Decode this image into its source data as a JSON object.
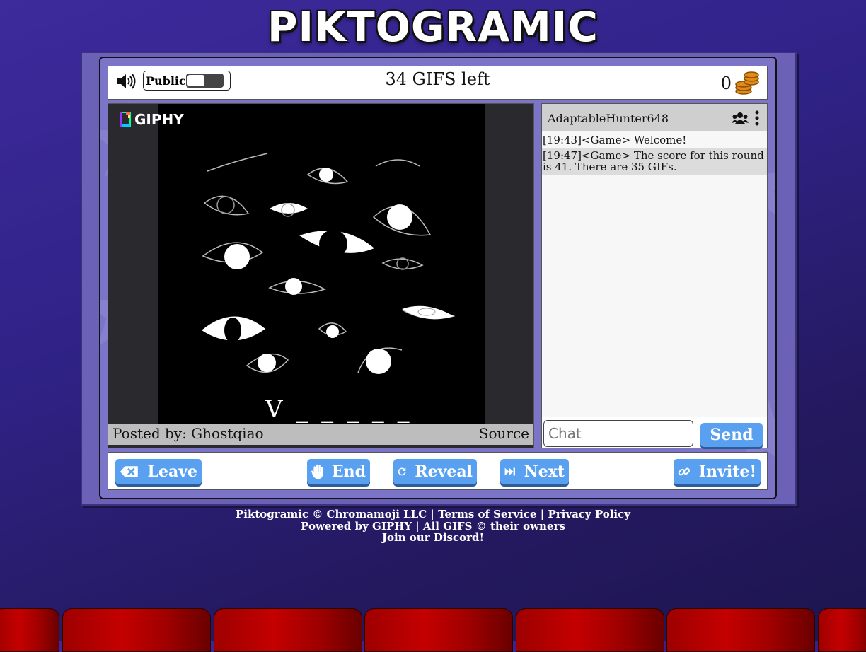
{
  "app": {
    "logo_text": "PIKTOGRAMIC"
  },
  "topbar": {
    "sound_icon": "speaker-icon",
    "public_label": "Public",
    "public_enabled": false,
    "gifs_left": "34 GIFS left",
    "coins": "0",
    "coins_icon": "coin-stack-icon"
  },
  "image": {
    "giphy_label": "GIPHY",
    "word_hint": "V _ _ _ _ _",
    "posted_by": "Posted by: Ghostqiao",
    "source_label": "Source"
  },
  "chat": {
    "username": "AdaptableHunter648",
    "users_icon": "users-icon",
    "menu_icon": "more-vertical-icon",
    "messages": [
      {
        "text": "[19:43]<Game> Welcome!"
      },
      {
        "text": "[19:47]<Game> The score for this round is 41. There are 35 GIFs."
      }
    ],
    "input_placeholder": "Chat",
    "input_value": "",
    "send_label": "Send"
  },
  "controls": {
    "leave_label": "Leave",
    "end_label": "End",
    "reveal_label": "Reveal",
    "next_label": "Next",
    "invite_label": "Invite!"
  },
  "footer": {
    "brand": "Piktogramic © Chromamoji LLC",
    "sep": " | ",
    "terms": "Terms of Service",
    "privacy": "Privacy Policy",
    "powered": "Powered by GIPHY | All GIFS © their owners",
    "discord": "Join our Discord!"
  },
  "colors": {
    "background": "#2f2286",
    "button": "#5aa0f0",
    "frame": "#7c74c6",
    "seat": "#c40000"
  }
}
